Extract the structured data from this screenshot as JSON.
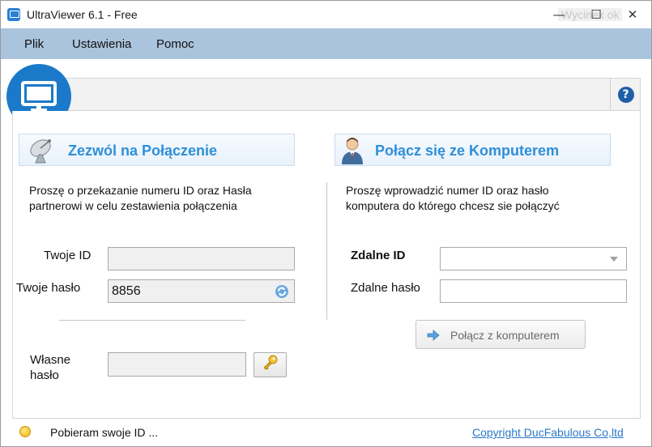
{
  "window": {
    "title": "UltraViewer 6.1 - Free",
    "ghost_text": "Wycinek ok",
    "minimize_glyph": "—",
    "maximize_glyph": "☐",
    "close_glyph": "✕"
  },
  "menu": {
    "items": [
      {
        "label": "Plik"
      },
      {
        "label": "Ustawienia"
      },
      {
        "label": "Pomoc"
      }
    ]
  },
  "toolbar": {
    "help_glyph": "?"
  },
  "allow_section": {
    "title": "Zezwól na Połączenie",
    "description_line1": "Proszę o przekazanie numeru ID oraz Hasła",
    "description_line2": "partnerowi w celu zestawienia połączenia",
    "your_id_label": "Twoje ID",
    "your_id_value": "",
    "your_password_label": "Twoje hasło",
    "your_password_value": "8856",
    "custom_password_label_line1": "Własne",
    "custom_password_label_line2": "hasło",
    "custom_password_value": ""
  },
  "connect_section": {
    "title": "Połącz się ze Komputerem",
    "description_line1": "Proszę wprowadzić numer ID oraz hasło",
    "description_line2": "komputera do którego chcesz sie połączyć",
    "remote_id_label": "Zdalne ID",
    "remote_id_value": "",
    "remote_password_label": "Zdalne hasło",
    "remote_password_value": "",
    "connect_button_label": "Połącz z komputerem"
  },
  "status": {
    "text": "Pobieram swoje ID ...",
    "copyright": "Copyright DucFabulous Co,ltd"
  },
  "colors": {
    "menu_bg": "#abc4dd",
    "accent_title": "#2e8fd9",
    "logo_bg": "#1b79c9",
    "link": "#2b78c7"
  }
}
